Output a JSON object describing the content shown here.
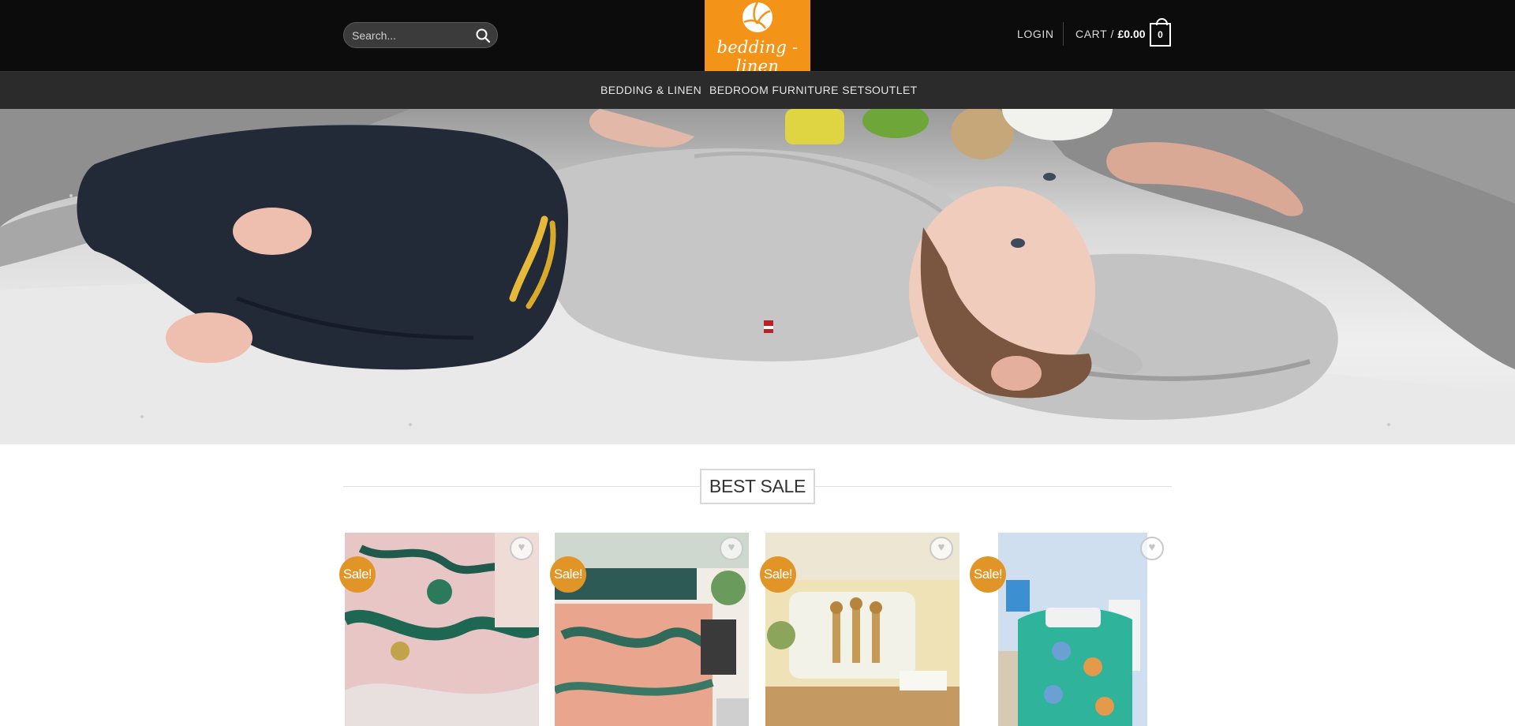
{
  "header": {
    "search_placeholder": "Search...",
    "logo_text": "bedding - linen",
    "login_label": "LOGIN",
    "cart_label": "CART /",
    "cart_amount": "£0.00",
    "cart_count": "0"
  },
  "nav": {
    "items": [
      {
        "label": "BEDDING & LINEN"
      },
      {
        "label": "BEDROOM FURNITURE SETS"
      },
      {
        "label": "OUTLET"
      }
    ]
  },
  "section": {
    "title": "BEST SALE"
  },
  "products": [
    {
      "badge": "Sale!",
      "image": "pink emerald dragon bedding"
    },
    {
      "badge": "Sale!",
      "image": "peach jungle zebra duvet set"
    },
    {
      "badge": "Sale!",
      "image": "giraffe print cushion and bedding"
    },
    {
      "badge": "Sale!",
      "image": "teal cartoon dog kids bedding"
    }
  ],
  "icons": {
    "search": "search-icon",
    "wishlist": "heart-icon",
    "logo": "volleyball-logo-icon"
  },
  "colors": {
    "header_bg": "#0c0c0c",
    "nav_bg": "#2b2b2b",
    "logo_bg": "#f39419",
    "sale_badge": "#e29527"
  }
}
